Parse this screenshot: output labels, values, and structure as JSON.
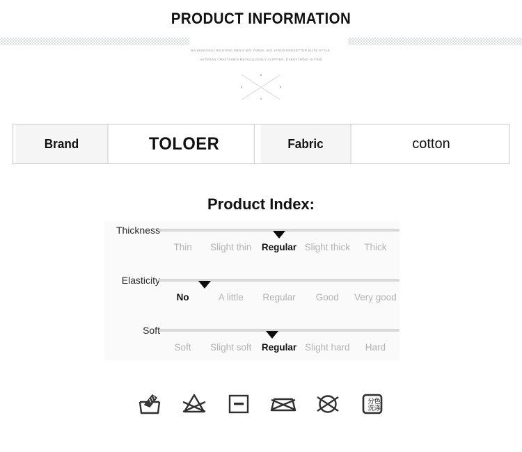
{
  "header": {
    "title": "PRODUCT INFORMATION",
    "subtitle_line1": "BAIWANGSHU HIGH-END MEN'S BIG YARDS, BIG YARDS ENDSETTER ELITE STYLE,",
    "subtitle_line2": "VETERAN CRAFTSMEN METICULOUSLY CLIPPING, EVERYTHING IS FINE",
    "ornament": "x-cross-ornament"
  },
  "spec_table": {
    "cells": [
      {
        "type": "label",
        "text": "Brand"
      },
      {
        "type": "value",
        "text": "TOLOER"
      },
      {
        "type": "label",
        "text": "Fabric"
      },
      {
        "type": "value",
        "text": "cotton"
      }
    ]
  },
  "product_index": {
    "title": "Product Index:",
    "rows": [
      {
        "name": "Thickness",
        "options": [
          "Thin",
          "Slight thin",
          "Regular",
          "Slight thick",
          "Thick"
        ],
        "selected_index": 2,
        "marker_percent": 50
      },
      {
        "name": "Elasticity",
        "options": [
          "No",
          "A little",
          "Regular",
          "Good",
          "Very good"
        ],
        "selected_index": 0,
        "marker_percent": 19
      },
      {
        "name": "Soft",
        "options": [
          "Soft",
          "Slight soft",
          "Regular",
          "Slight hard",
          "Hard"
        ],
        "selected_index": 2,
        "marker_percent": 47
      }
    ]
  },
  "care_icons": [
    {
      "name": "hand-wash-icon",
      "label": "hand wash"
    },
    {
      "name": "do-not-bleach-icon",
      "label": "do not bleach"
    },
    {
      "name": "dry-flat-icon",
      "label": "dry flat"
    },
    {
      "name": "do-not-wring-icon",
      "label": "do not wring"
    },
    {
      "name": "do-not-dry-clean-icon",
      "label": "do not dry clean"
    },
    {
      "name": "wash-separately-by-color-icon",
      "label": "分色洗涤"
    }
  ],
  "colors": {
    "text": "#111111",
    "muted": "#b3b3b3",
    "track": "#d8d8d8",
    "panel": "#fafafa",
    "border": "#c9c9c9",
    "label_cell": "#f5f5f5"
  }
}
